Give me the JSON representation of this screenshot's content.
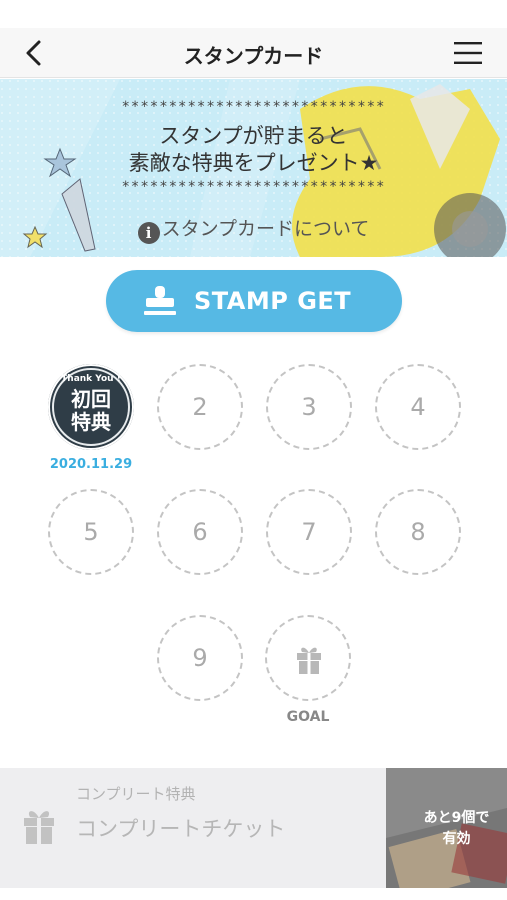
{
  "header": {
    "title": "スタンプカード",
    "back_icon": "chevron-left-icon",
    "menu_icon": "hamburger-menu-icon"
  },
  "banner": {
    "stars_top": "****************************",
    "message_line1": "スタンプが貯まると",
    "message_line2": "素敵な特典をプレゼント★",
    "stars_bottom": "****************************",
    "about_icon": "info-icon",
    "about_text": "スタンプカードについて"
  },
  "stamp_button": {
    "label": "STAMP GET",
    "icon": "stamp-icon",
    "color": "#56b9e4"
  },
  "card": {
    "first_stamp": {
      "thank_you": "Thank You !",
      "line1": "初回",
      "line2": "特典",
      "date": "2020.11.29"
    },
    "slots": [
      "2",
      "3",
      "4",
      "5",
      "6",
      "7",
      "8",
      "9"
    ],
    "goal_icon": "gift-icon",
    "goal_label": "GOAL"
  },
  "complete": {
    "gift_icon": "gift-icon",
    "subtitle": "コンプリート特典",
    "name": "コンプリートチケット",
    "remaining_line1": "あと9個で",
    "remaining_line2": "有効"
  },
  "colors": {
    "accent": "#56b9e4",
    "date": "#3aaee0",
    "stamp_dark": "#2f3d47",
    "banner_bg": "#c9ecf7"
  }
}
